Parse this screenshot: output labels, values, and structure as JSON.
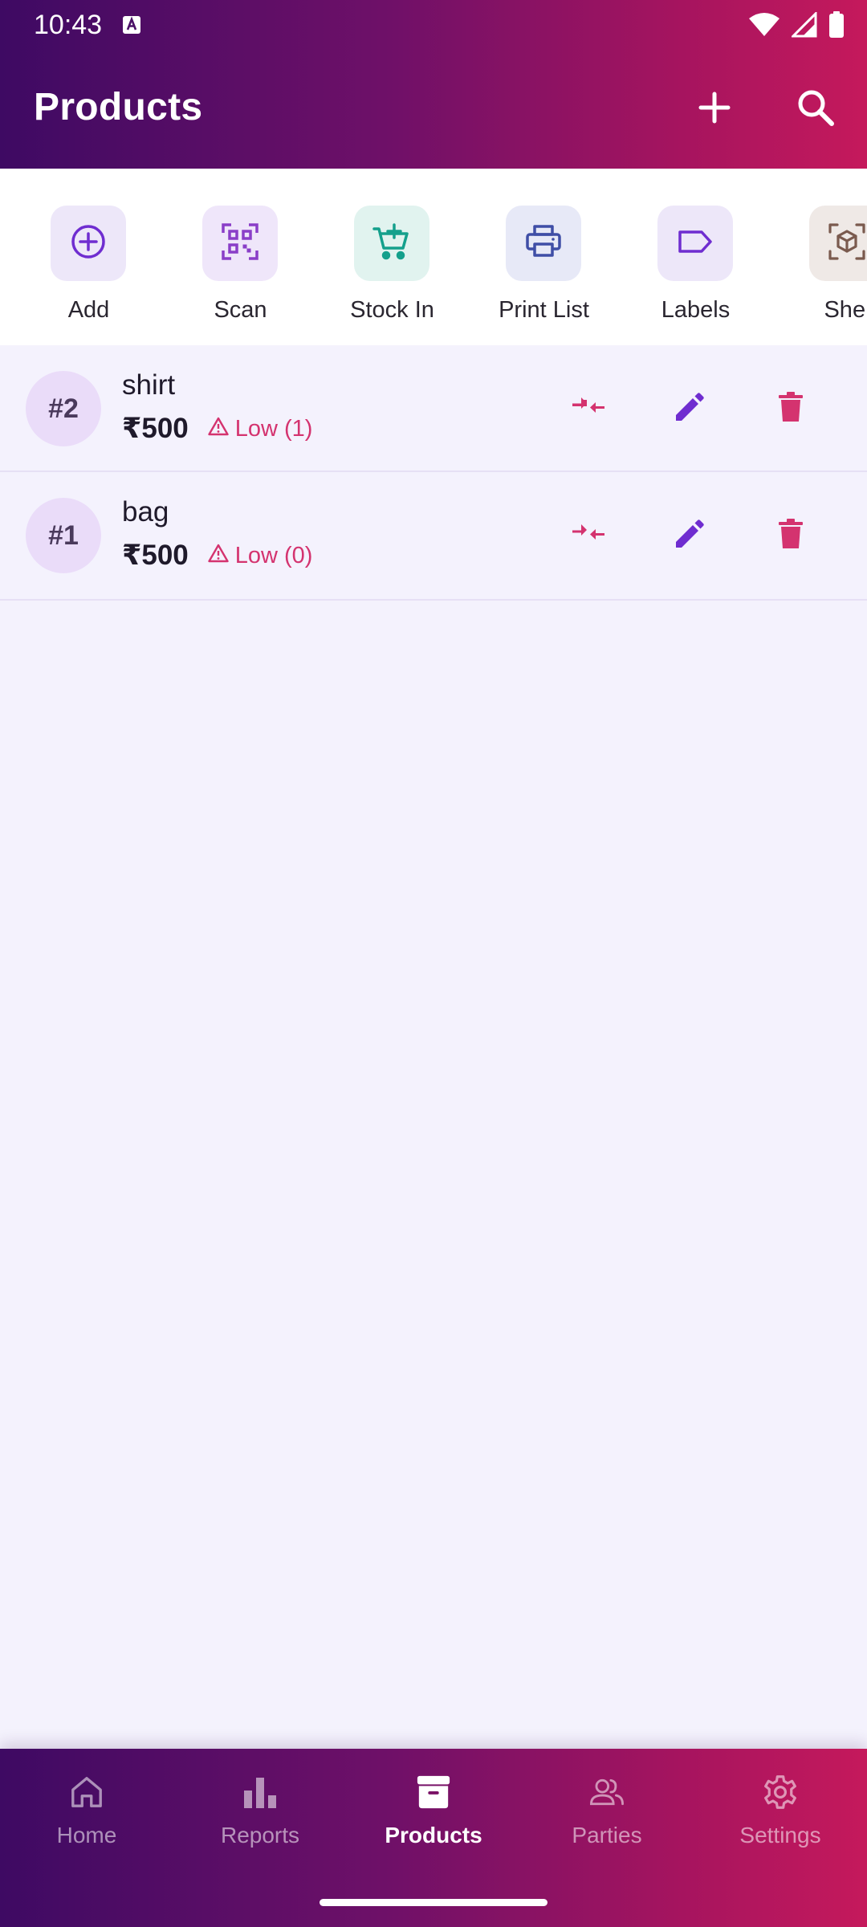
{
  "status_bar": {
    "time": "10:43",
    "icons": [
      "a-notification-icon",
      "wifi-icon",
      "signal-icon",
      "battery-icon"
    ]
  },
  "app_bar": {
    "title": "Products",
    "actions": [
      "add-icon",
      "search-icon"
    ]
  },
  "quick_actions": [
    {
      "label": "Add",
      "icon": "add-circle-icon",
      "bg": "#ede7f9",
      "color": "#6f2dd0"
    },
    {
      "label": "Scan",
      "icon": "qr-scan-icon",
      "bg": "#efe6fa",
      "color": "#8a3ec8"
    },
    {
      "label": "Stock In",
      "icon": "cart-add-icon",
      "bg": "#e1f3ef",
      "color": "#14a08c"
    },
    {
      "label": "Print List",
      "icon": "printer-icon",
      "bg": "#e7e9f7",
      "color": "#3f4ea6"
    },
    {
      "label": "Labels",
      "icon": "label-tag-icon",
      "bg": "#ede7f9",
      "color": "#6f2dd0"
    },
    {
      "label": "Shel",
      "icon": "shelf-box-icon",
      "bg": "#efe9e6",
      "color": "#7a5a4e"
    }
  ],
  "products": [
    {
      "number": "#2",
      "name": "shirt",
      "price": "₹500",
      "stock_status": "Low (1)"
    },
    {
      "number": "#1",
      "name": "bag",
      "price": "₹500",
      "stock_status": "Low (0)"
    }
  ],
  "row_actions": [
    "adjust-stock-icon",
    "edit-icon",
    "delete-icon"
  ],
  "colors": {
    "accent_purple": "#6f2dd0",
    "warning_pink": "#d4336f",
    "header_gradient_start": "#3e0a63",
    "header_gradient_end": "#c5195c",
    "list_background": "#f4f2fd"
  },
  "bottom_nav": {
    "items": [
      {
        "label": "Home",
        "icon": "home-icon"
      },
      {
        "label": "Reports",
        "icon": "bar-chart-icon"
      },
      {
        "label": "Products",
        "icon": "archive-box-icon"
      },
      {
        "label": "Parties",
        "icon": "people-icon"
      },
      {
        "label": "Settings",
        "icon": "gear-icon"
      }
    ],
    "active": "Products"
  }
}
